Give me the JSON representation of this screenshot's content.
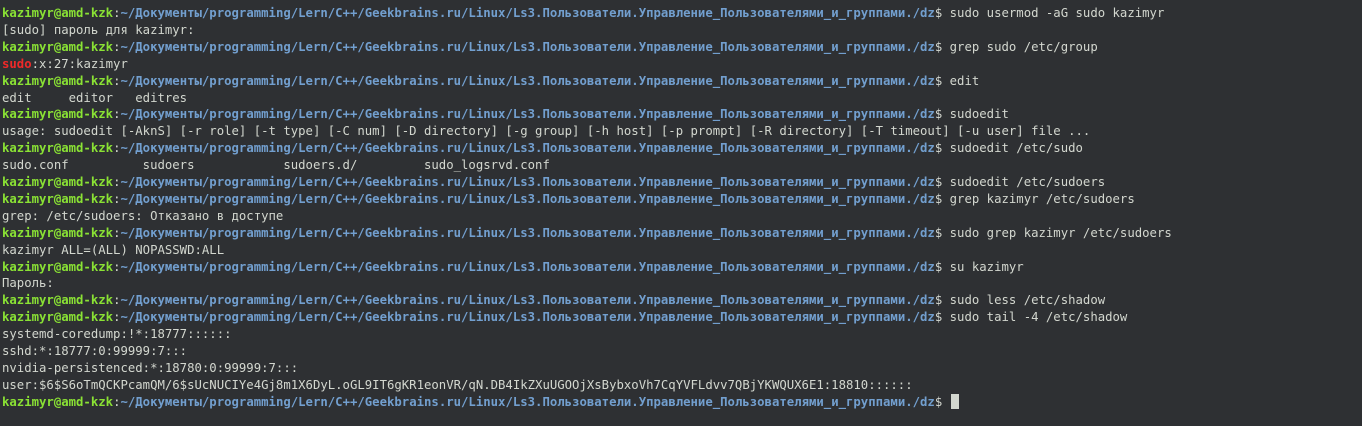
{
  "prompt": {
    "user_host": "kazimyr@amd-kzk",
    "colon": ":",
    "path": "~/Документы/programming/Lern/C++/Geekbrains.ru/Linux/Ls3.Пользователи.Управление_Пользователями_и_группами./dz",
    "dollar": "$ "
  },
  "lines": [
    {
      "type": "prompt",
      "cmd": "sudo usermod -aG sudo kazimyr"
    },
    {
      "type": "output",
      "text": "[sudo] пароль для kazimyr:"
    },
    {
      "type": "prompt",
      "cmd": "grep sudo /etc/group"
    },
    {
      "type": "grep",
      "highlight": "sudo",
      "text": ":x:27:kazimyr"
    },
    {
      "type": "prompt",
      "cmd": "edit"
    },
    {
      "type": "output",
      "text": "edit     editor   editres"
    },
    {
      "type": "prompt",
      "cmd": "sudoedit"
    },
    {
      "type": "output",
      "text": "usage: sudoedit [-AknS] [-r role] [-t type] [-C num] [-D directory] [-g group] [-h host] [-p prompt] [-R directory] [-T timeout] [-u user] file ..."
    },
    {
      "type": "prompt",
      "cmd": "sudoedit /etc/sudo"
    },
    {
      "type": "output",
      "text": "sudo.conf          sudoers            sudoers.d/         sudo_logsrvd.conf"
    },
    {
      "type": "prompt",
      "cmd": "sudoedit /etc/sudoers"
    },
    {
      "type": "prompt",
      "cmd": "grep kazimyr /etc/sudoers"
    },
    {
      "type": "output",
      "text": "grep: /etc/sudoers: Отказано в доступе"
    },
    {
      "type": "prompt",
      "cmd": "sudo grep kazimyr /etc/sudoers"
    },
    {
      "type": "output",
      "text": "kazimyr ALL=(ALL) NOPASSWD:ALL"
    },
    {
      "type": "prompt",
      "cmd": "su kazimyr"
    },
    {
      "type": "output",
      "text": "Пароль:"
    },
    {
      "type": "prompt",
      "cmd": "sudo less /etc/shadow"
    },
    {
      "type": "prompt",
      "cmd": "sudo tail -4 /etc/shadow"
    },
    {
      "type": "output",
      "text": "systemd-coredump:!*:18777::::::"
    },
    {
      "type": "output",
      "text": "sshd:*:18777:0:99999:7:::"
    },
    {
      "type": "output",
      "text": "nvidia-persistenced:*:18780:0:99999:7:::"
    },
    {
      "type": "output",
      "text": "user:$6$S6oTmQCKPcamQM/6$sUcNUCIYe4Gj8m1X6DyL.oGL9IT6gKR1eonVR/qN.DB4IkZXuUGOOjXsBybxoVh7CqYVFLdvv7QBjYKWQUX6E1:18810::::::"
    },
    {
      "type": "prompt_cursor",
      "cmd": ""
    }
  ],
  "colors": {
    "background": "#2e3033",
    "text": "#d3d7cf",
    "user_host": "#8ae234",
    "path": "#729fcf",
    "grep_match": "#ef2929"
  }
}
